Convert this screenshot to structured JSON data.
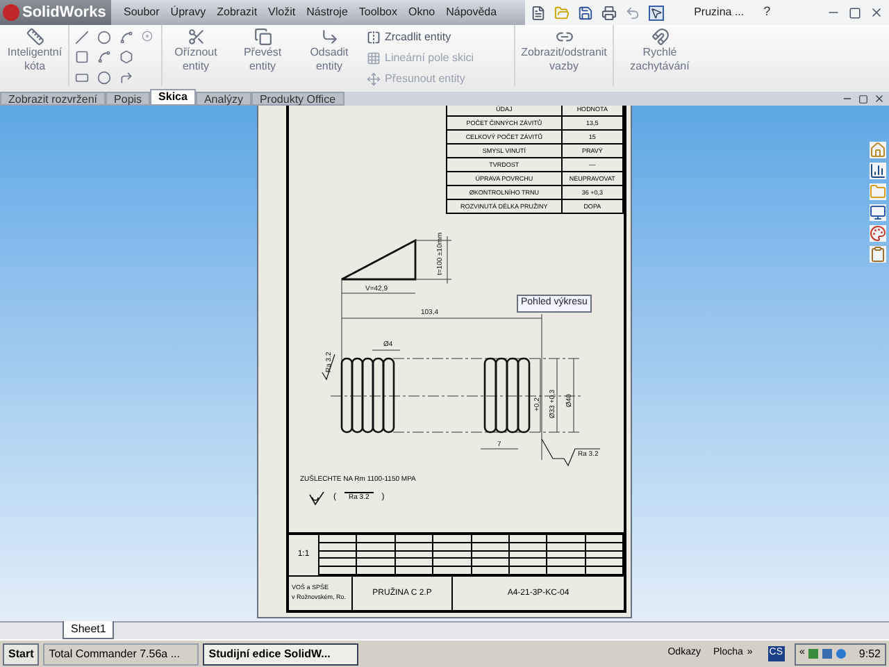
{
  "app": {
    "logo": "SolidWorks",
    "document": "Pruzina ...",
    "help": "?"
  },
  "menu": [
    "Soubor",
    "Úpravy",
    "Zobrazit",
    "Vložit",
    "Nástroje",
    "Toolbox",
    "Okno",
    "Nápověda"
  ],
  "ribbon": {
    "big": [
      {
        "kind": "dim",
        "label": "Inteligentní kóta"
      },
      {
        "kind": "trim",
        "label": "Oříznout entity"
      },
      {
        "kind": "convert",
        "label": "Převést entity"
      },
      {
        "kind": "offset",
        "label": "Odsadit entity"
      },
      {
        "kind": "relations",
        "label": "Zobrazit/odstranit vazby"
      },
      {
        "kind": "snap",
        "label": "Rychlé zachytávání"
      }
    ],
    "list": [
      {
        "kind": "mirror",
        "label": "Zrcadlit entity",
        "disabled": false
      },
      {
        "kind": "pattern",
        "label": "Lineární pole skici",
        "disabled": true
      },
      {
        "kind": "move",
        "label": "Přesunout entity",
        "disabled": true
      }
    ]
  },
  "tabs": [
    {
      "label": "Zobrazit rozvržení",
      "selected": false
    },
    {
      "label": "Popis",
      "selected": false
    },
    {
      "label": "Skica",
      "selected": true
    },
    {
      "label": "Analýzy",
      "selected": false
    },
    {
      "label": "Produkty Office",
      "selected": false
    }
  ],
  "spec_table": {
    "columns": [
      "ÚDAJ",
      "HODNOTA"
    ],
    "rows": [
      [
        "POČET ČINNÝCH ZÁVITŮ",
        "13,5"
      ],
      [
        "CELKOVÝ POČET ZÁVITŮ",
        "15"
      ],
      [
        "SMYSL VINUTÍ",
        "PRAVÝ"
      ],
      [
        "TVRDOST",
        "—"
      ],
      [
        "ÚPRAVA POVRCHU",
        "NEUPRAVOVAT"
      ],
      [
        "ØKONTROLNÍHO TRNU",
        "36 +0,3"
      ],
      [
        "ROZVINUTÁ DÉLKA PRUŽINY",
        "DOPA"
      ]
    ]
  },
  "drawing": {
    "height": "t=100 ±10mm",
    "length": "V=42,9",
    "total": "103,4",
    "wire": "Ø4",
    "tol": "+0,2",
    "inner": "Ø33 +0,3",
    "outer": "Ø40",
    "pitch": "7",
    "rough_left": "Ra 3.2",
    "rough_right": "Ra 3.2"
  },
  "tooltip": "Pohled výkresu",
  "note": "ZUŠLECHTE NA Rm 1100-1150 MPA",
  "note_rough": "Ra 3.2",
  "paren_open": "(",
  "paren_close": ")",
  "title_block": {
    "scale": "1:1",
    "school": "VOŠ a SPŠE",
    "school_2": "v Rožnovském, Ro.",
    "part": "PRUŽINA C 2.P",
    "number": "A4-21-3P-KC-04"
  },
  "sheets": [
    {
      "label": "Sheet1",
      "selected": true
    }
  ],
  "taskbar": {
    "start": "Start",
    "tasks": [
      {
        "label": "Total Commander 7.56a ...",
        "selected": false
      },
      {
        "label": "Studijní edice SolidW...",
        "selected": true
      }
    ],
    "links": "Odkazy",
    "desktop": "Plocha",
    "more": "»",
    "lang": "CS",
    "expand": "«",
    "clock": "9:52"
  }
}
